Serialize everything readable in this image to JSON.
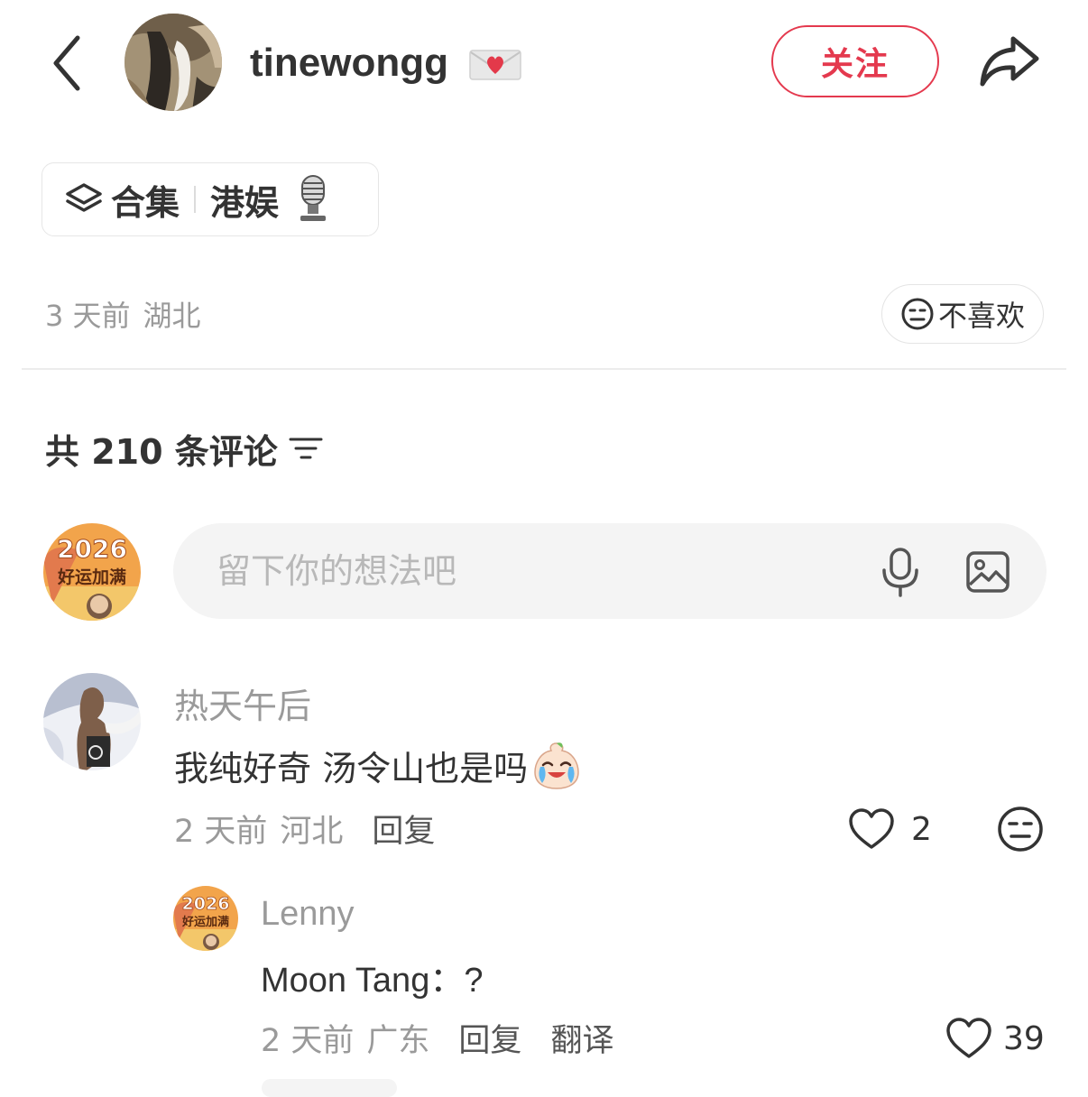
{
  "header": {
    "author_name": "tinewongg",
    "follow_label": "关注"
  },
  "collection": {
    "label": "合集",
    "topic": "港娱"
  },
  "post": {
    "time": "3 天前",
    "location": "湖北",
    "dislike_label": "不喜欢"
  },
  "comments_header": {
    "count_text": "共 210 条评论"
  },
  "comment_input": {
    "placeholder": "留下你的想法吧"
  },
  "my_avatar": {
    "year": "2026",
    "slogan": "好运加满"
  },
  "comments": [
    {
      "author": "热天午后",
      "text": "我纯好奇 汤令山也是吗",
      "time": "2 天前",
      "location": "河北",
      "reply_label": "回复",
      "likes": "2",
      "replies": [
        {
          "author": "Lenny",
          "text": "Moon Tang：?",
          "time": "2 天前",
          "location": "广东",
          "reply_label": "回复",
          "translate_label": "翻译",
          "likes": "39",
          "avatar_year": "2026",
          "avatar_slogan": "好运加满"
        }
      ]
    }
  ],
  "colors": {
    "accent": "#e4394e",
    "text_primary": "#333333",
    "text_secondary": "#9a9a9a",
    "input_bg": "#f4f4f4"
  },
  "icons": {
    "back": "chevron-left-icon",
    "share": "share-arrow-icon",
    "collection": "layers-icon",
    "dislike": "neutral-face-icon",
    "sort": "sort-lines-icon",
    "voice": "microphone-icon",
    "image": "image-icon",
    "like": "heart-outline-icon"
  }
}
